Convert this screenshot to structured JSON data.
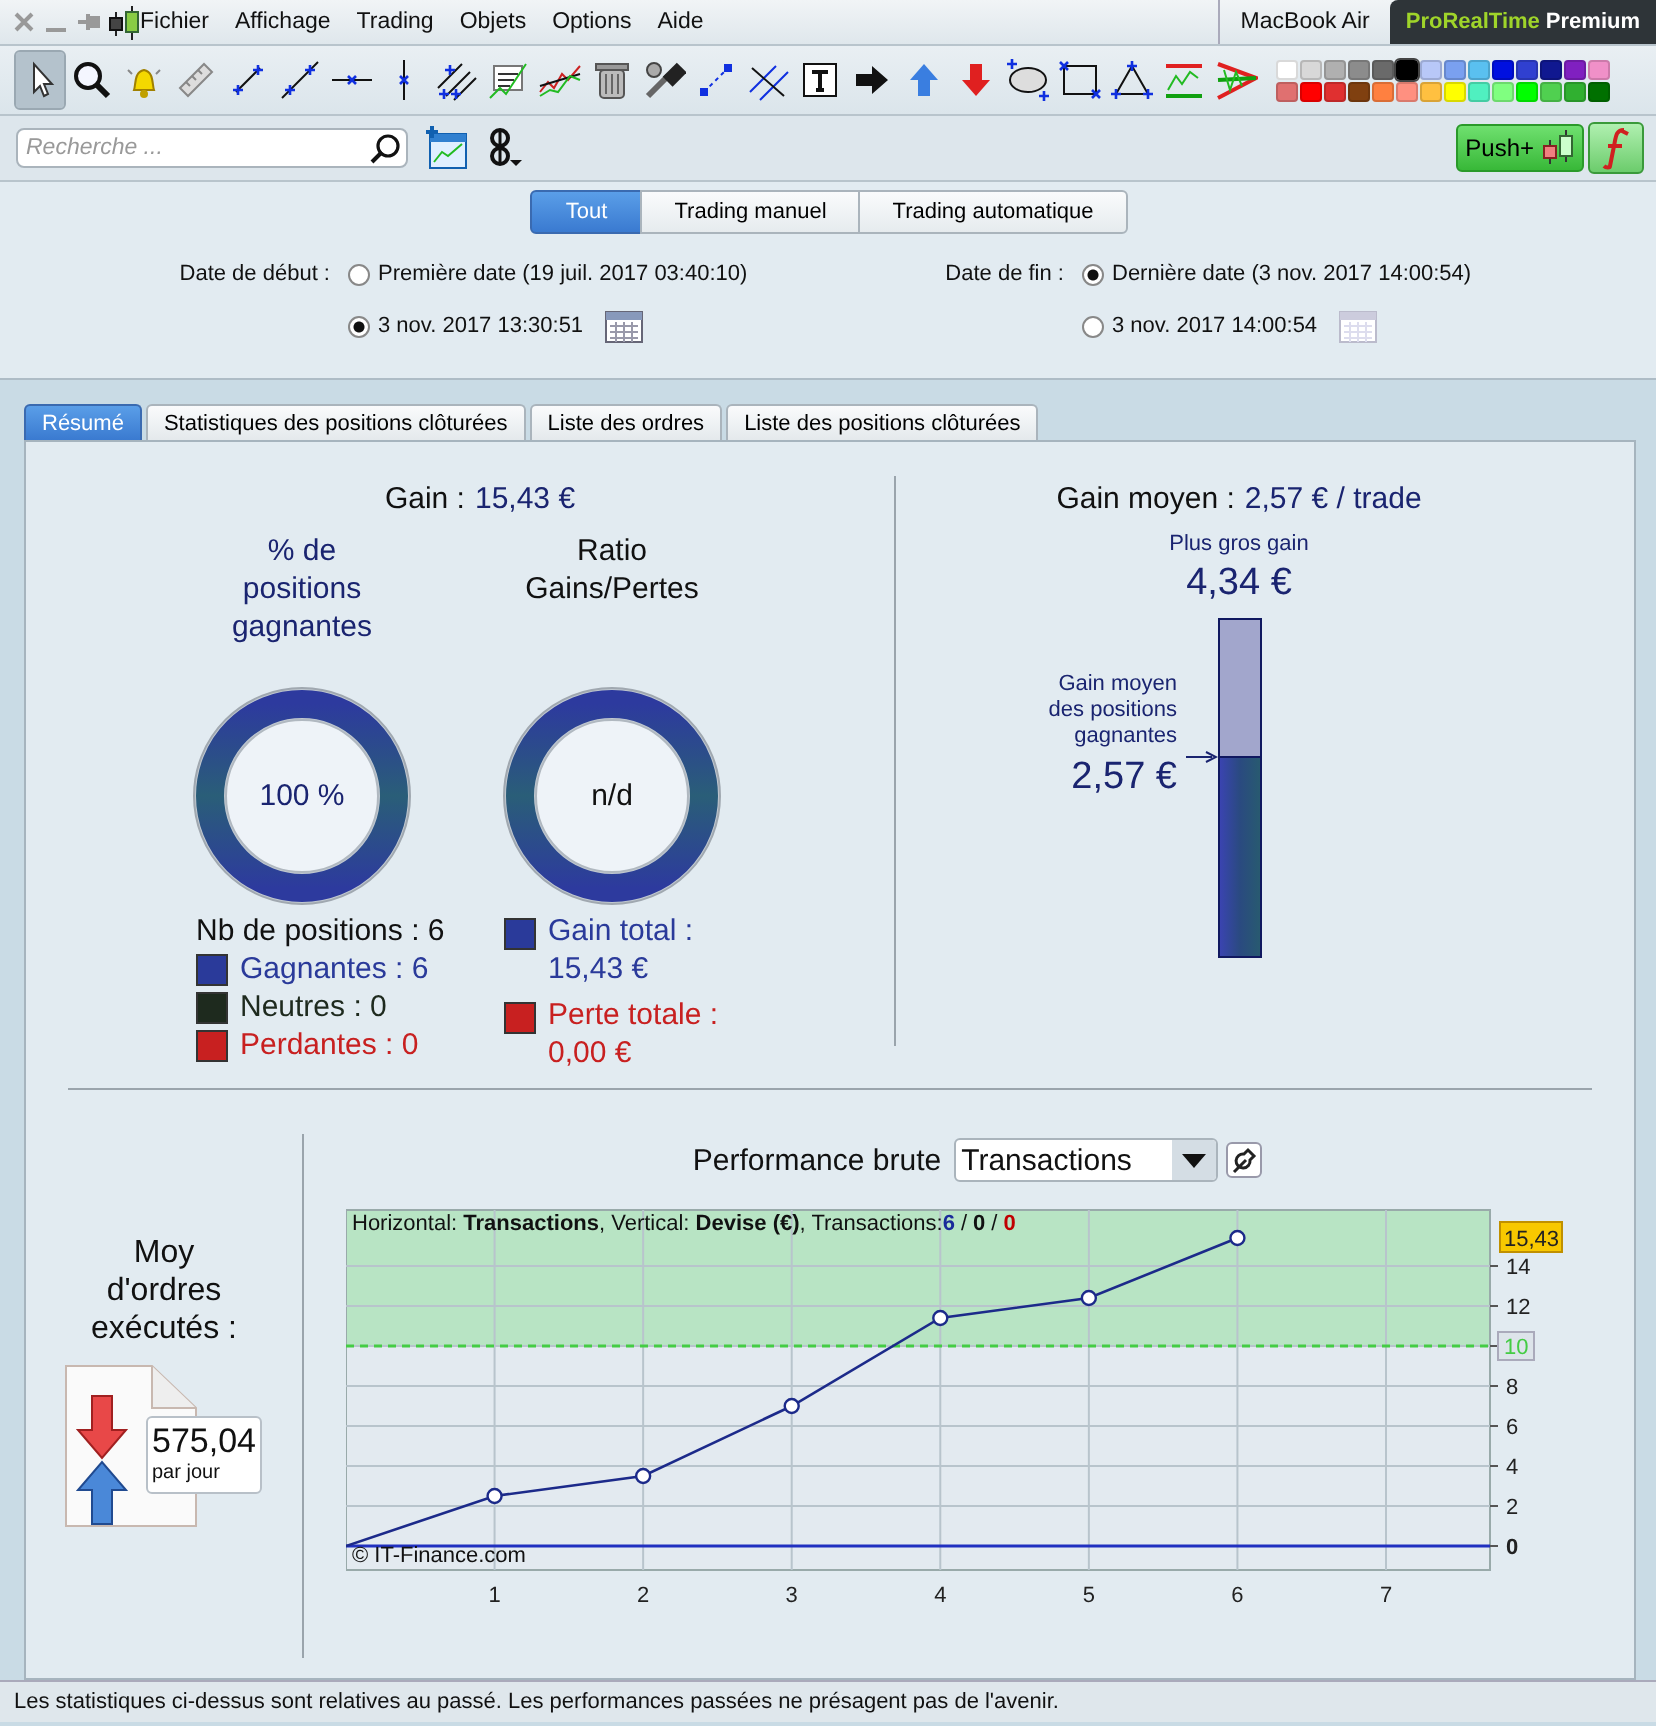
{
  "menu": [
    {
      "label": "Fichier"
    },
    {
      "label": "Affichage"
    },
    {
      "label": "Trading"
    },
    {
      "label": "Objets"
    },
    {
      "label": "Options"
    },
    {
      "label": "Aide"
    }
  ],
  "device": "MacBook Air",
  "product": {
    "brand": "ProRealTime",
    "edition": "Premium"
  },
  "tools": [
    {
      "selected": true
    },
    {
      "selected": false
    },
    {
      "selected": false
    },
    {
      "selected": false
    },
    {
      "selected": false
    },
    {
      "selected": false
    },
    {
      "selected": false
    },
    {
      "selected": false
    },
    {
      "selected": false
    },
    {
      "selected": false
    },
    {
      "selected": false
    },
    {
      "selected": false
    },
    {
      "selected": false
    },
    {
      "selected": false
    },
    {
      "selected": false
    },
    {
      "selected": false
    },
    {
      "selected": false
    },
    {
      "selected": false
    },
    {
      "selected": false
    },
    {
      "selected": false
    },
    {
      "selected": false
    },
    {
      "selected": false
    },
    {
      "selected": false
    },
    {
      "selected": false
    }
  ],
  "palette": [
    {
      "color": "#ffffff",
      "selected": false
    },
    {
      "color": "#d8d8d8",
      "selected": false
    },
    {
      "color": "#b0b0b0",
      "selected": false
    },
    {
      "color": "#8c8c8c",
      "selected": false
    },
    {
      "color": "#6a6a6a",
      "selected": false
    },
    {
      "color": "#000000",
      "selected": true
    },
    {
      "color": "#b8c8f8",
      "selected": false
    },
    {
      "color": "#7aa0f0",
      "selected": false
    },
    {
      "color": "#5ac0f0",
      "selected": false
    },
    {
      "color": "#0010e0",
      "selected": false
    },
    {
      "color": "#3040d0",
      "selected": false
    },
    {
      "color": "#101890",
      "selected": false
    },
    {
      "color": "#8020c0",
      "selected": false
    },
    {
      "color": "#f090c8",
      "selected": false
    },
    {
      "color": "#e07070",
      "selected": false
    },
    {
      "color": "#ff0000",
      "selected": false
    },
    {
      "color": "#e03030",
      "selected": false
    },
    {
      "color": "#804010",
      "selected": false
    },
    {
      "color": "#ff8040",
      "selected": false
    },
    {
      "color": "#ff9080",
      "selected": false
    },
    {
      "color": "#ffc040",
      "selected": false
    },
    {
      "color": "#ffff00",
      "selected": false
    },
    {
      "color": "#50f0c0",
      "selected": false
    },
    {
      "color": "#80ff80",
      "selected": false
    },
    {
      "color": "#00ff00",
      "selected": false
    },
    {
      "color": "#50d050",
      "selected": false
    },
    {
      "color": "#30b030",
      "selected": false
    },
    {
      "color": "#007000",
      "selected": false
    }
  ],
  "search": {
    "placeholder": "Recherche ..."
  },
  "push_button": {
    "label": "Push+"
  },
  "filters": [
    {
      "label": "Tout",
      "selected": true
    },
    {
      "label": "Trading manuel",
      "selected": false
    },
    {
      "label": "Trading automatique",
      "selected": false
    }
  ],
  "date_start": {
    "label": "Date de début :",
    "options": [
      {
        "label": "Première date (19 juil. 2017 03:40:10)",
        "selected": false,
        "calendar": false
      },
      {
        "label": "3 nov. 2017 13:30:51",
        "selected": true,
        "calendar": true
      }
    ]
  },
  "date_end": {
    "label": "Date de fin :",
    "options": [
      {
        "label": "Dernière date (3 nov. 2017 14:00:54)",
        "selected": true,
        "calendar": false
      },
      {
        "label": "3 nov. 2017 14:00:54",
        "selected": false,
        "calendar": true
      }
    ]
  },
  "tabs": [
    {
      "label": "Résumé",
      "selected": true
    },
    {
      "label": "Statistiques des positions clôturées",
      "selected": false
    },
    {
      "label": "Liste des ordres",
      "selected": false
    },
    {
      "label": "Liste des positions clôturées",
      "selected": false
    }
  ],
  "gain": {
    "label": "Gain :",
    "value": "15,43 €"
  },
  "win_rate": {
    "title": "% de positions gagnantes",
    "value": "100 %",
    "count": "Nb de positions : 6",
    "legend": [
      {
        "label": "Gagnantes : 6",
        "color": "#2a3a9a"
      },
      {
        "label": "Neutres : 0",
        "color": "#1e2a1e"
      },
      {
        "label": "Perdantes : 0",
        "color": "#c82020"
      }
    ]
  },
  "ratio": {
    "title": "Ratio Gains/Pertes",
    "value": "n/d",
    "legend": [
      {
        "label": "Gain total : 15,43 €",
        "color": "#2a3a9a"
      },
      {
        "label": "Perte totale : 0,00 €",
        "color": "#c82020"
      }
    ]
  },
  "average_gain": {
    "label": "Gain moyen :",
    "value": "2,57 € / trade",
    "max_label": "Plus gros gain",
    "max_value": "4,34 €",
    "avg_label": "Gain moyen des positions gagnantes",
    "avg_value": "2,57 €",
    "level": 0.59
  },
  "orders": {
    "title": "Moy d'ordres exécutés :",
    "value": "575,04",
    "unit": "par jour"
  },
  "performance": {
    "title": "Performance brute",
    "mode": "Transactions",
    "info": "Horizontal: **Transactions**, Vertical: **Devise (€)**, Transactions:",
    "counts": [
      {
        "label": "6",
        "color": "#1a2a9a"
      },
      {
        "label": "0",
        "color": "#111111"
      },
      {
        "label": "0",
        "color": "#c00000"
      }
    ],
    "separator": "/",
    "copyright": "© IT-Finance.com",
    "chart_data": {
      "type": "line",
      "x": [
        0,
        1,
        2,
        3,
        4,
        5,
        6
      ],
      "series": [
        {
          "color": "#1c2a8a",
          "marker": "o",
          "values": [
            0,
            2.5,
            3.5,
            7,
            11.4,
            12.4,
            15.4
          ]
        }
      ],
      "xlim": [
        0,
        7.7
      ],
      "ylim": [
        -1.2,
        16.8
      ],
      "xticks": [
        1,
        2,
        3,
        4,
        5,
        6,
        7
      ],
      "yticks": [
        0,
        2,
        4,
        6,
        8,
        10,
        12,
        14
      ],
      "grid": true,
      "bands": [
        {
          "axis": "y",
          "from": 10,
          "to": 16.8,
          "color": "#b8e4c4"
        }
      ],
      "ref_lines": [
        {
          "axis": "y",
          "value": 10,
          "label": "10",
          "color": "#44cc44"
        },
        {
          "axis": "y",
          "value": 0,
          "color": "#2030c0"
        }
      ],
      "annotations": [
        "15,43"
      ]
    }
  },
  "status_bar": "Les statistiques ci-dessus sont relatives au passé. Les performances passées ne présagent pas de l'avenir."
}
